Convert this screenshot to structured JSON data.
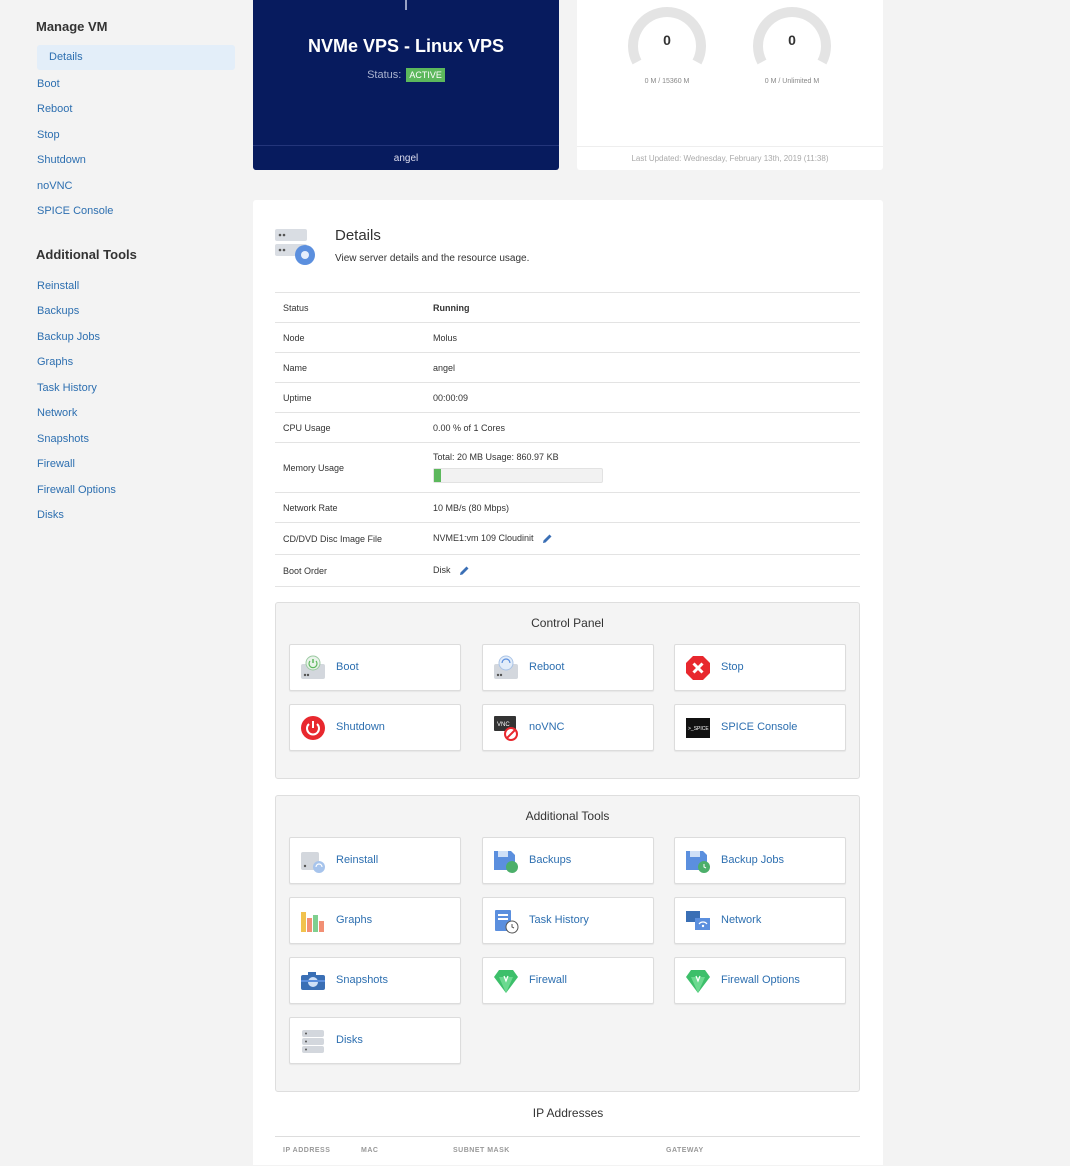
{
  "sidebar": {
    "manage_heading": "Manage VM",
    "manage_items": [
      {
        "label": "Details"
      },
      {
        "label": "Boot"
      },
      {
        "label": "Reboot"
      },
      {
        "label": "Stop"
      },
      {
        "label": "Shutdown"
      },
      {
        "label": "noVNC"
      },
      {
        "label": "SPICE Console"
      }
    ],
    "tools_heading": "Additional Tools",
    "tools_items": [
      {
        "label": "Reinstall"
      },
      {
        "label": "Backups"
      },
      {
        "label": "Backup Jobs"
      },
      {
        "label": "Graphs"
      },
      {
        "label": "Task History"
      },
      {
        "label": "Network"
      },
      {
        "label": "Snapshots"
      },
      {
        "label": "Firewall"
      },
      {
        "label": "Firewall Options"
      },
      {
        "label": "Disks"
      }
    ]
  },
  "product": {
    "title": "NVMe VPS - Linux VPS",
    "status_label": "Status:",
    "status_value": "ACTIVE",
    "hostname": "angel"
  },
  "usage": {
    "gauges": [
      {
        "value": "0",
        "caption": "0 M / 15360 M"
      },
      {
        "value": "0",
        "caption": "0 M / Unlimited M"
      }
    ],
    "last_updated": "Last Updated: Wednesday, February 13th, 2019 (11:38)"
  },
  "details": {
    "title": "Details",
    "description": "View server details and the resource usage.",
    "rows": {
      "status": {
        "label": "Status",
        "value": "Running"
      },
      "node": {
        "label": "Node",
        "value": "Molus"
      },
      "name": {
        "label": "Name",
        "value": "angel"
      },
      "uptime": {
        "label": "Uptime",
        "value": "00:00:09"
      },
      "cpu": {
        "label": "CPU Usage",
        "value": "0.00 % of 1 Cores"
      },
      "memory": {
        "label": "Memory Usage",
        "value": "Total: 20 MB Usage: 860.97 KB",
        "bar_fraction": 0.04
      },
      "network": {
        "label": "Network Rate",
        "value": "10 MB/s (80 Mbps)"
      },
      "cdrom": {
        "label": "CD/DVD Disc Image File",
        "value": "NVME1:vm 109 Cloudinit"
      },
      "boot": {
        "label": "Boot Order",
        "value": "Disk"
      }
    }
  },
  "control_panel": {
    "title": "Control Panel",
    "buttons": [
      {
        "label": "Boot",
        "icon": "boot-icon"
      },
      {
        "label": "Reboot",
        "icon": "reboot-icon"
      },
      {
        "label": "Stop",
        "icon": "stop-icon"
      },
      {
        "label": "Shutdown",
        "icon": "shutdown-icon"
      },
      {
        "label": "noVNC",
        "icon": "vnc-icon"
      },
      {
        "label": "SPICE Console",
        "icon": "spice-icon"
      }
    ]
  },
  "tools_panel": {
    "title": "Additional Tools",
    "buttons": [
      {
        "label": "Reinstall",
        "icon": "reinstall-icon"
      },
      {
        "label": "Backups",
        "icon": "backups-icon"
      },
      {
        "label": "Backup Jobs",
        "icon": "backup-jobs-icon"
      },
      {
        "label": "Graphs",
        "icon": "graphs-icon"
      },
      {
        "label": "Task History",
        "icon": "task-history-icon"
      },
      {
        "label": "Network",
        "icon": "network-icon"
      },
      {
        "label": "Snapshots",
        "icon": "snapshots-icon"
      },
      {
        "label": "Firewall",
        "icon": "firewall-icon"
      },
      {
        "label": "Firewall Options",
        "icon": "firewall-options-icon"
      },
      {
        "label": "Disks",
        "icon": "disks-icon"
      }
    ]
  },
  "ip_addresses": {
    "title": "IP Addresses",
    "columns": [
      "IP ADDRESS",
      "MAC",
      "SUBNET MASK",
      "GATEWAY"
    ]
  },
  "colors": {
    "brand_navy": "#071b5e",
    "link_blue": "#2d6fb0",
    "active_green": "#5cb85c",
    "running_green": "#2f8a2f"
  }
}
